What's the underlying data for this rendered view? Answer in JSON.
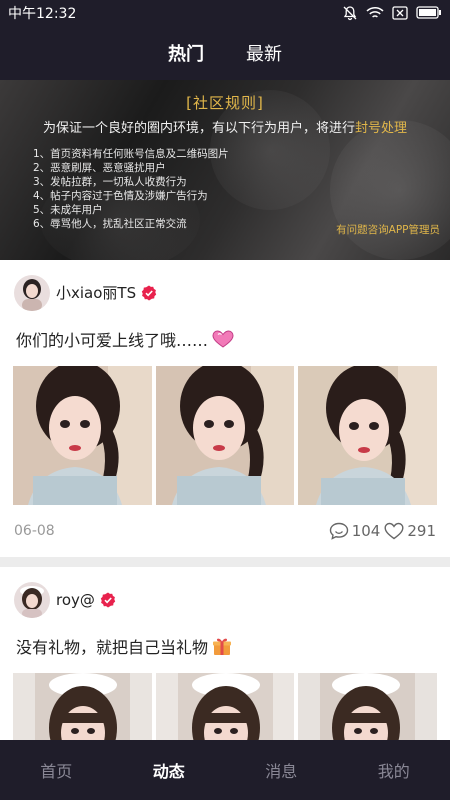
{
  "status_bar": {
    "time": "中午12:32"
  },
  "top_tabs": [
    {
      "label": "热门",
      "active": true
    },
    {
      "label": "最新",
      "active": false
    }
  ],
  "banner": {
    "title": "[社区规则]",
    "intro_prefix": "为保证一个良好的圈内环境，有以下行为用户，将进行",
    "intro_highlight": "封号处理",
    "rules": [
      "1、首页资料有任何账号信息及二维码图片",
      "2、恶意刷屏、恶意骚扰用户",
      "3、发帖拉群，一切私人收费行为",
      "4、帖子内容过于色情及涉嫌广告行为",
      "5、未成年用户",
      "6、辱骂他人，扰乱社区正常交流"
    ],
    "contact": "有问题咨询APP管理员"
  },
  "posts": [
    {
      "username": "小xiao丽TS",
      "text": "你们的小可爱上线了哦……",
      "emoji": "heart-emoji",
      "date": "06-08",
      "comments": "104",
      "likes": "291"
    },
    {
      "username": "roy@",
      "text": "没有礼物，就把自己当礼物",
      "emoji": "gift-emoji"
    }
  ],
  "bottom_nav": [
    {
      "label": "首页",
      "active": false
    },
    {
      "label": "动态",
      "active": true
    },
    {
      "label": "消息",
      "active": false
    },
    {
      "label": "我的",
      "active": false
    }
  ],
  "colors": {
    "nav_bg": "#1f1d2a",
    "accent_gold": "#e0b64a",
    "verified_red": "#e8224d"
  }
}
